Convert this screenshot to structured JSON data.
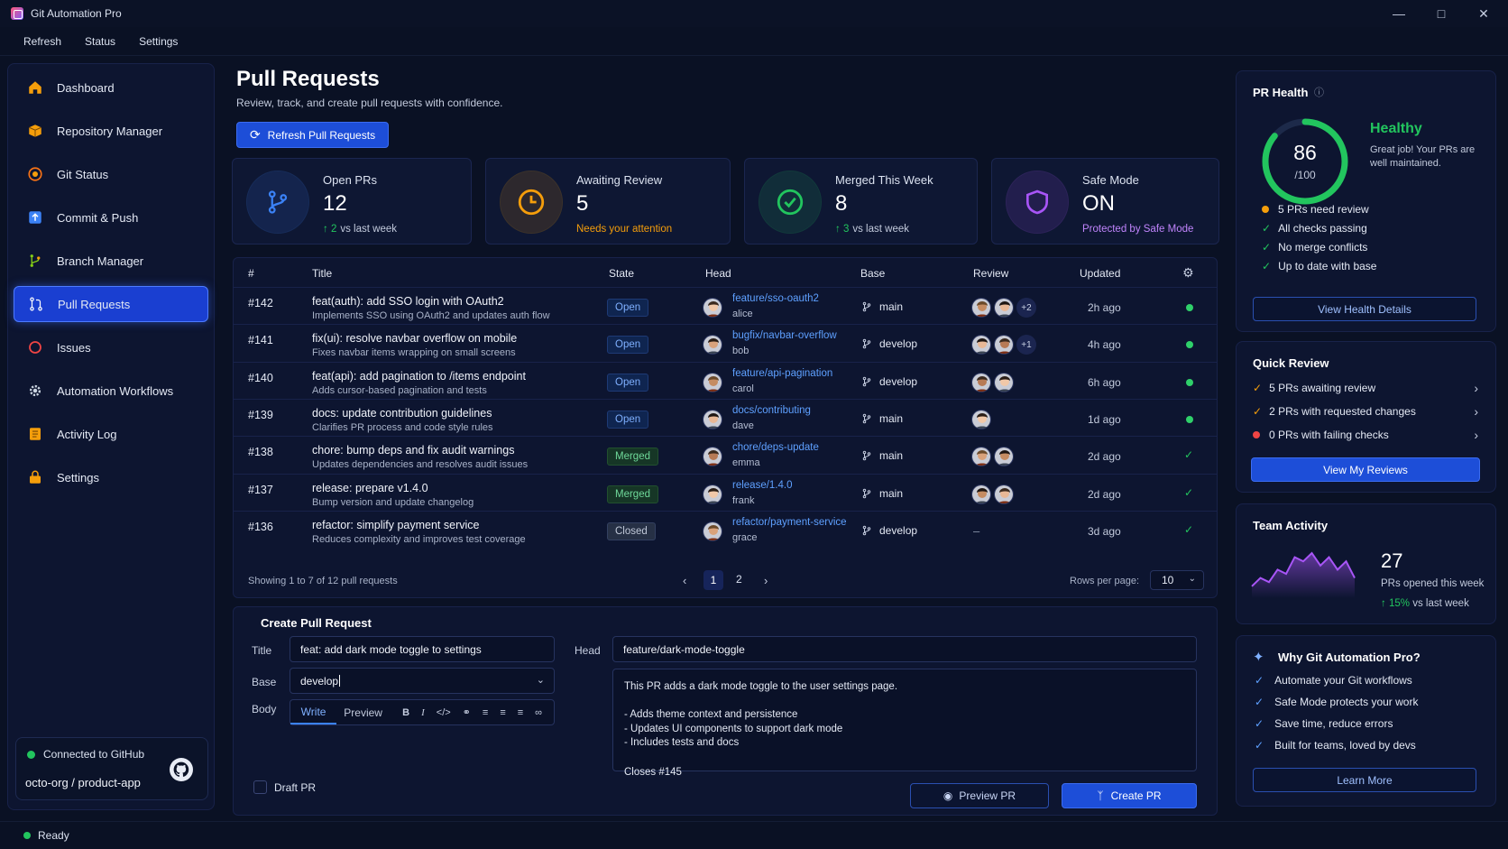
{
  "app": {
    "title": "Git Automation Pro"
  },
  "menu": [
    "Refresh",
    "Status",
    "Settings"
  ],
  "sidebar": {
    "items": [
      {
        "label": "Dashboard",
        "icon": "home-icon"
      },
      {
        "label": "Repository Manager",
        "icon": "box-icon"
      },
      {
        "label": "Git Status",
        "icon": "status-icon"
      },
      {
        "label": "Commit & Push",
        "icon": "upload-icon"
      },
      {
        "label": "Branch Manager",
        "icon": "branch-icon"
      },
      {
        "label": "Pull Requests",
        "icon": "pull-request-icon",
        "active": true
      },
      {
        "label": "Issues",
        "icon": "issue-icon"
      },
      {
        "label": "Automation Workflows",
        "icon": "gear-icon"
      },
      {
        "label": "Activity Log",
        "icon": "log-icon"
      },
      {
        "label": "Settings",
        "icon": "lock-icon"
      }
    ],
    "connection": {
      "status": "Connected to GitHub",
      "repo": "octo-org / product-app"
    }
  },
  "header": {
    "title": "Pull Requests",
    "subtitle": "Review, track, and create pull requests with confidence.",
    "refresh_label": "Refresh Pull Requests"
  },
  "stats": [
    {
      "label": "Open PRs",
      "value": "12",
      "delta": "2",
      "note": "vs last week",
      "color": "#3b82f6"
    },
    {
      "label": "Awaiting Review",
      "value": "5",
      "note": "Needs your attention",
      "color": "#f59e0b"
    },
    {
      "label": "Merged This Week",
      "value": "8",
      "delta": "3",
      "note": "vs last week",
      "color": "#22c55e"
    },
    {
      "label": "Safe Mode",
      "value": "ON",
      "note": "Protected by Safe Mode",
      "color": "#a855f7"
    }
  ],
  "table": {
    "columns": [
      "#",
      "Title",
      "State",
      "Head",
      "Base",
      "Review",
      "Updated"
    ],
    "rows": [
      {
        "num": "#142",
        "title": "feat(auth): add SSO login with OAuth2",
        "desc": "Implements SSO using OAuth2 and updates auth flow",
        "state": "Open",
        "branch": "feature/sso-oauth2",
        "user": "alice",
        "base": "main",
        "reviewers": 2,
        "more": "+2",
        "updated": "2h ago",
        "status": "dot"
      },
      {
        "num": "#141",
        "title": "fix(ui): resolve navbar overflow on mobile",
        "desc": "Fixes navbar items wrapping on small screens",
        "state": "Open",
        "branch": "bugfix/navbar-overflow",
        "user": "bob",
        "base": "develop",
        "reviewers": 2,
        "more": "+1",
        "updated": "4h ago",
        "status": "dot"
      },
      {
        "num": "#140",
        "title": "feat(api): add pagination to /items endpoint",
        "desc": "Adds cursor-based pagination and tests",
        "state": "Open",
        "branch": "feature/api-pagination",
        "user": "carol",
        "base": "develop",
        "reviewers": 2,
        "more": "",
        "updated": "6h ago",
        "status": "dot"
      },
      {
        "num": "#139",
        "title": "docs: update contribution guidelines",
        "desc": "Clarifies PR process and code style rules",
        "state": "Open",
        "branch": "docs/contributing",
        "user": "dave",
        "base": "main",
        "reviewers": 1,
        "more": "",
        "updated": "1d ago",
        "status": "dot"
      },
      {
        "num": "#138",
        "title": "chore: bump deps and fix audit warnings",
        "desc": "Updates dependencies and resolves audit issues",
        "state": "Merged",
        "branch": "chore/deps-update",
        "user": "emma",
        "base": "main",
        "reviewers": 2,
        "more": "",
        "updated": "2d ago",
        "status": "check"
      },
      {
        "num": "#137",
        "title": "release: prepare v1.4.0",
        "desc": "Bump version and update changelog",
        "state": "Merged",
        "branch": "release/1.4.0",
        "user": "frank",
        "base": "main",
        "reviewers": 2,
        "more": "",
        "updated": "2d ago",
        "status": "check"
      },
      {
        "num": "#136",
        "title": "refactor: simplify payment service",
        "desc": "Reduces complexity and improves test coverage",
        "state": "Closed",
        "branch": "refactor/payment-service",
        "user": "grace",
        "base": "develop",
        "reviewers": 0,
        "dash": "–",
        "more": "",
        "updated": "3d ago",
        "status": "check"
      }
    ],
    "footer": "Showing 1 to 7 of 12 pull requests",
    "pages": [
      "1",
      "2"
    ],
    "rows_per_page_label": "Rows per page:",
    "rows_per_page": "10"
  },
  "create": {
    "heading": "Create Pull Request",
    "title_label": "Title",
    "title_value": "feat: add dark mode toggle to settings",
    "head_label": "Head",
    "head_value": "feature/dark-mode-toggle",
    "base_label": "Base",
    "base_value": "develop",
    "body_label": "Body",
    "tab_write": "Write",
    "tab_preview": "Preview",
    "body_lines": [
      "This PR adds a dark mode toggle to the user settings page.",
      "",
      "- Adds theme context and persistence",
      "- Updates UI components to support dark mode",
      "- Includes tests and docs",
      "",
      "Closes #145"
    ],
    "draft_label": "Draft PR",
    "preview_btn": "Preview PR",
    "create_btn": "Create PR"
  },
  "health": {
    "title": "PR Health",
    "score": "86",
    "max": "/100",
    "score_value": 86,
    "status": "Healthy",
    "message": "Great job! Your PRs are well maintained.",
    "checks": [
      {
        "text": "5 PRs need review",
        "kind": "warn"
      },
      {
        "text": "All checks passing",
        "kind": "ok"
      },
      {
        "text": "No merge conflicts",
        "kind": "ok"
      },
      {
        "text": "Up to date with base",
        "kind": "ok"
      }
    ],
    "button": "View Health Details"
  },
  "quick": {
    "title": "Quick Review",
    "items": [
      {
        "text": "5 PRs awaiting review",
        "kind": "warn"
      },
      {
        "text": "2 PRs with requested changes",
        "kind": "warn"
      },
      {
        "text": "0 PRs with failing checks",
        "kind": "err"
      }
    ],
    "button": "View My Reviews"
  },
  "team": {
    "title": "Team Activity",
    "value": "27",
    "label": "PRs opened this week",
    "delta": "15%",
    "delta_note": "vs last week",
    "spark": [
      2,
      4,
      3,
      6,
      5,
      9,
      8,
      10,
      7,
      9,
      6,
      8,
      4
    ]
  },
  "why": {
    "title": "Why Git Automation Pro?",
    "items": [
      "Automate your Git workflows",
      "Safe Mode protects your work",
      "Save time, reduce errors",
      "Built for teams, loved by devs"
    ],
    "button": "Learn More"
  },
  "statusbar": {
    "text": "Ready"
  }
}
